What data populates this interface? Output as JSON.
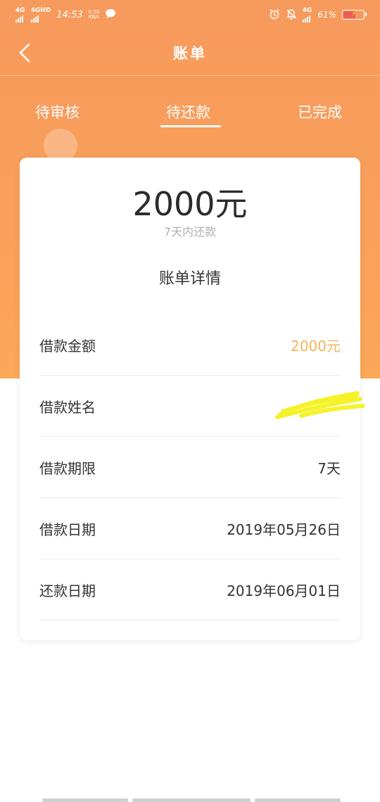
{
  "status_bar": {
    "net1": "4G",
    "net2": "4GHD",
    "time": "14:53",
    "speed_value": "0.50",
    "speed_unit": "KB/s",
    "net3": "4G",
    "battery_percent": "61%",
    "battery_level": 0.61
  },
  "nav": {
    "title": "账单"
  },
  "tabs": [
    {
      "label": "待审核"
    },
    {
      "label": "待还款",
      "active": true
    },
    {
      "label": "已完成"
    }
  ],
  "bill": {
    "amount": "2000元",
    "amount_note": "7天内还款",
    "detail_title": "账单详情",
    "rows": [
      {
        "label": "借款金额",
        "value": "2000元"
      },
      {
        "label": "借款姓名",
        "value": ""
      },
      {
        "label": "借款期限",
        "value": "7天"
      },
      {
        "label": "借款日期",
        "value": "2019年05月26日"
      },
      {
        "label": "还款日期",
        "value": "2019年06月01日"
      }
    ]
  },
  "colors": {
    "header_orange": "#f79a5d",
    "accent_amount": "#f4b35c",
    "redaction_yellow": "#f5f22a"
  },
  "icons": {
    "back": "chevron-left-icon",
    "alarm": "alarm-icon",
    "mute": "bell-off-icon",
    "message": "chat-bubble-icon"
  }
}
